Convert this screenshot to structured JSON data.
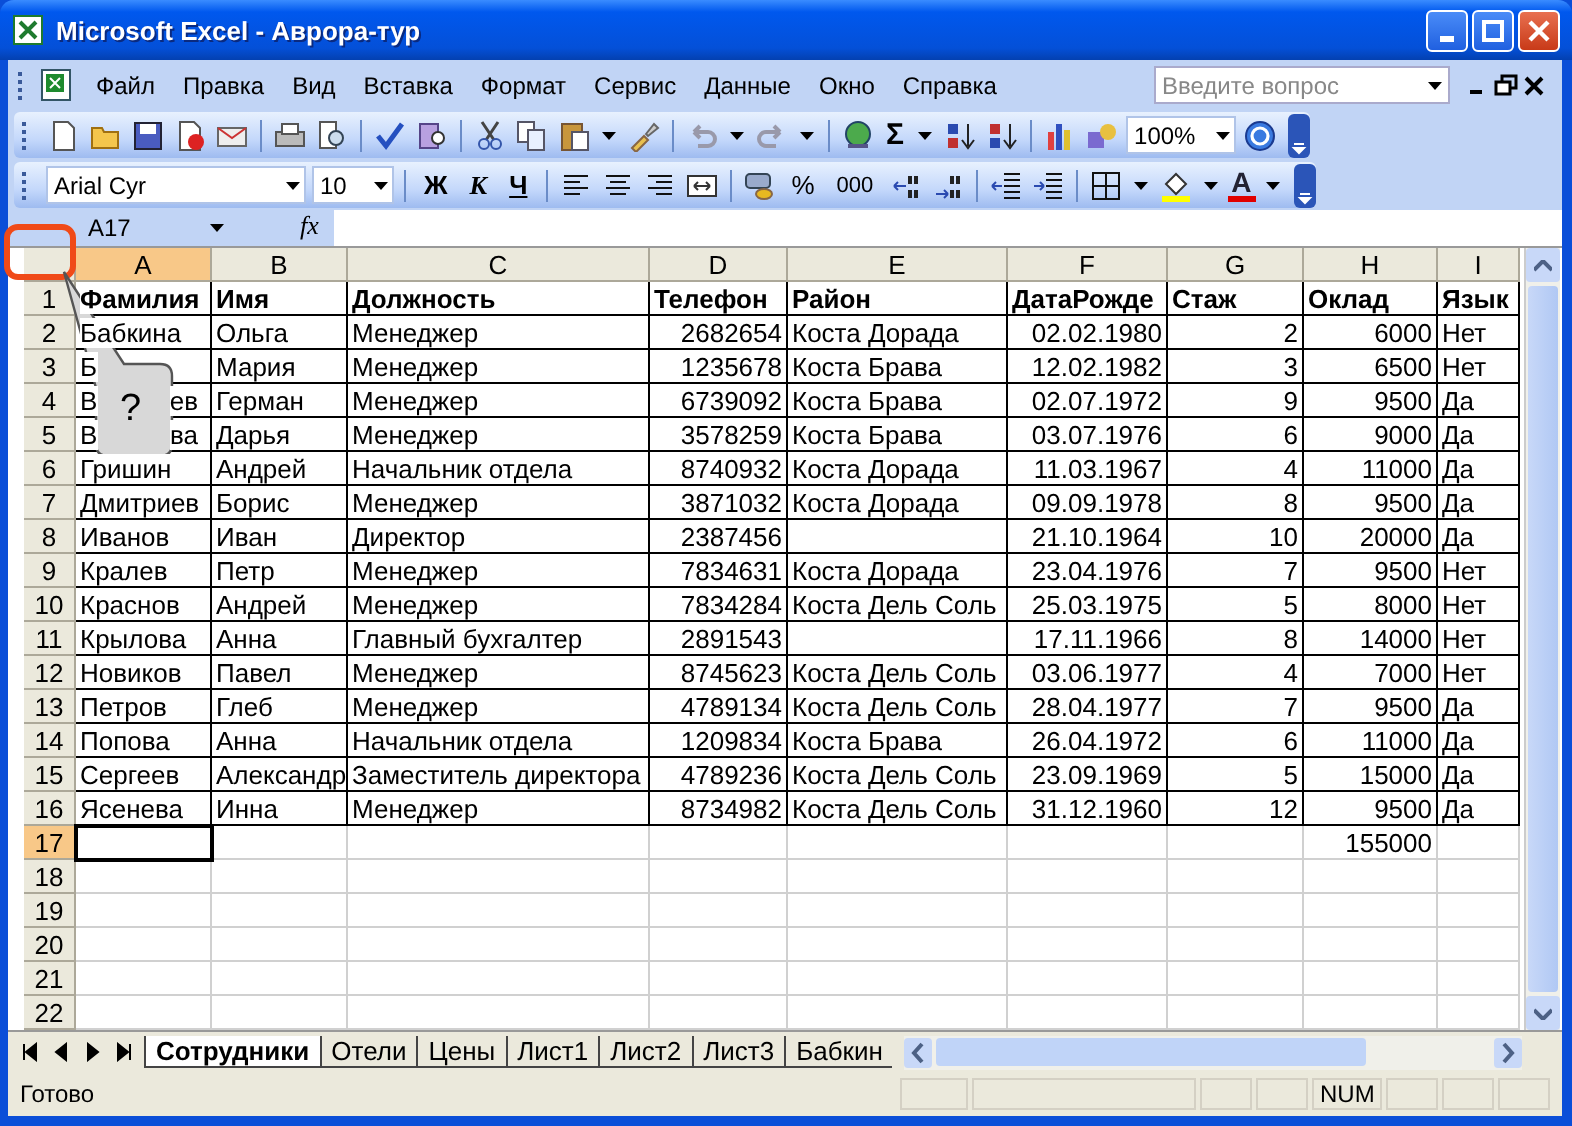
{
  "window": {
    "title": "Microsoft Excel - Аврора-тур"
  },
  "menu": [
    {
      "label": "Файл"
    },
    {
      "label": "Правка"
    },
    {
      "label": "Вид"
    },
    {
      "label": "Вставка"
    },
    {
      "label": "Формат"
    },
    {
      "label": "Сервис"
    },
    {
      "label": "Данные"
    },
    {
      "label": "Окно"
    },
    {
      "label": "Справка"
    }
  ],
  "help_search": {
    "placeholder": "Введите вопрос"
  },
  "standard_toolbar": {
    "sum": "Σ",
    "zoom": "100%"
  },
  "formatting_toolbar": {
    "font": "Arial Cyr",
    "size": "10",
    "bold": "Ж",
    "italic": "К",
    "underline": "Ч",
    "percent": "%",
    "thousands": "000",
    "font_color": "A"
  },
  "formula_bar": {
    "name_box": "A17",
    "fx": "fx"
  },
  "sheet": {
    "columns": [
      {
        "label": "A",
        "selected": true,
        "numeric": false
      },
      {
        "label": "B",
        "selected": false,
        "numeric": false
      },
      {
        "label": "C",
        "selected": false,
        "numeric": false
      },
      {
        "label": "D",
        "selected": false,
        "numeric": true
      },
      {
        "label": "E",
        "selected": false,
        "numeric": false
      },
      {
        "label": "F",
        "selected": false,
        "numeric": true
      },
      {
        "label": "G",
        "selected": false,
        "numeric": true
      },
      {
        "label": "H",
        "selected": false,
        "numeric": true
      },
      {
        "label": "I",
        "selected": false,
        "numeric": false
      }
    ],
    "rows": [
      {
        "number": "1",
        "selected": false,
        "kind": "header",
        "cells": [
          "Фамилия",
          "Имя",
          "Должность",
          "Телефон",
          "Район",
          "ДатаРожде",
          "Стаж",
          "Оклад",
          "Язык"
        ]
      },
      {
        "number": "2",
        "selected": false,
        "kind": "data",
        "cells": [
          "Бабкина",
          "Ольга",
          "Менеджер",
          "2682654",
          "Коста Дорада",
          "02.02.1980",
          "2",
          "6000",
          "Нет"
        ]
      },
      {
        "number": "3",
        "selected": false,
        "kind": "data",
        "cells": [
          {
            "head": "Б"
          },
          "Мария",
          "Менеджер",
          "1235678",
          "Коста Брава",
          "12.02.1982",
          "3",
          "6500",
          "Нет"
        ]
      },
      {
        "number": "4",
        "selected": false,
        "kind": "data",
        "cells": [
          {
            "head": "В",
            "tail": "ев"
          },
          "Герман",
          "Менеджер",
          "6739092",
          "Коста Брава",
          "02.07.1972",
          "9",
          "9500",
          "Да"
        ]
      },
      {
        "number": "5",
        "selected": false,
        "kind": "data",
        "cells": [
          {
            "head": "В",
            "tail": "ва"
          },
          "Дарья",
          "Менеджер",
          "3578259",
          "Коста Брава",
          "03.07.1976",
          "6",
          "9000",
          "Да"
        ]
      },
      {
        "number": "6",
        "selected": false,
        "kind": "data",
        "cells": [
          "Гришин",
          "Андрей",
          "Начальник отдела",
          "8740932",
          "Коста Дорада",
          "11.03.1967",
          "4",
          "11000",
          "Да"
        ]
      },
      {
        "number": "7",
        "selected": false,
        "kind": "data",
        "cells": [
          "Дмитриев",
          "Борис",
          "Менеджер",
          "3871032",
          "Коста Дорада",
          "09.09.1978",
          "8",
          "9500",
          "Да"
        ]
      },
      {
        "number": "8",
        "selected": false,
        "kind": "data",
        "cells": [
          "Иванов",
          "Иван",
          "Директор",
          "2387456",
          null,
          "21.10.1964",
          "10",
          "20000",
          "Да"
        ]
      },
      {
        "number": "9",
        "selected": false,
        "kind": "data",
        "cells": [
          "Кралев",
          "Петр",
          "Менеджер",
          "7834631",
          "Коста Дорада",
          "23.04.1976",
          "7",
          "9500",
          "Нет"
        ]
      },
      {
        "number": "10",
        "selected": false,
        "kind": "data",
        "cells": [
          "Краснов",
          "Андрей",
          "Менеджер",
          "7834284",
          "Коста Дель Соль",
          "25.03.1975",
          "5",
          "8000",
          "Нет"
        ]
      },
      {
        "number": "11",
        "selected": false,
        "kind": "data",
        "cells": [
          "Крылова",
          "Анна",
          "Главный бухгалтер",
          "2891543",
          null,
          "17.11.1966",
          "8",
          "14000",
          "Нет"
        ]
      },
      {
        "number": "12",
        "selected": false,
        "kind": "data",
        "cells": [
          "Новиков",
          "Павел",
          "Менеджер",
          "8745623",
          "Коста Дель Соль",
          "03.06.1977",
          "4",
          "7000",
          "Нет"
        ]
      },
      {
        "number": "13",
        "selected": false,
        "kind": "data",
        "cells": [
          "Петров",
          "Глеб",
          "Менеджер",
          "4789134",
          "Коста Дель Соль",
          "28.04.1977",
          "7",
          "9500",
          "Да"
        ]
      },
      {
        "number": "14",
        "selected": false,
        "kind": "data",
        "cells": [
          "Попова",
          "Анна",
          "Начальник отдела",
          "1209834",
          "Коста Брава",
          "26.04.1972",
          "6",
          "11000",
          "Да"
        ]
      },
      {
        "number": "15",
        "selected": false,
        "kind": "data",
        "cells": [
          "Сергеев",
          "Александр",
          "Заместитель директора",
          "4789236",
          "Коста Дель Соль",
          "23.09.1969",
          "5",
          "15000",
          "Да"
        ]
      },
      {
        "number": "16",
        "selected": false,
        "kind": "data",
        "cells": [
          "Ясенева",
          "Инна",
          "Менеджер",
          "8734982",
          "Коста Дель Соль",
          "31.12.1960",
          "12",
          "9500",
          "Да"
        ]
      },
      {
        "number": "17",
        "selected": true,
        "kind": "empty",
        "cells": [
          null,
          null,
          null,
          null,
          null,
          null,
          null,
          "155000",
          null
        ]
      },
      {
        "number": "18",
        "selected": false,
        "kind": "empty"
      },
      {
        "number": "19",
        "selected": false,
        "kind": "empty"
      },
      {
        "number": "20",
        "selected": false,
        "kind": "empty"
      },
      {
        "number": "21",
        "selected": false,
        "kind": "empty"
      },
      {
        "number": "22",
        "selected": false,
        "kind": "empty"
      }
    ]
  },
  "callout": {
    "text": "?"
  },
  "sheet_tabs": [
    {
      "label": "Сотрудники",
      "selected": true
    },
    {
      "label": "Отели",
      "selected": false
    },
    {
      "label": "Цены",
      "selected": false
    },
    {
      "label": "Лист1",
      "selected": false
    },
    {
      "label": "Лист2",
      "selected": false
    },
    {
      "label": "Лист3",
      "selected": false
    },
    {
      "label": "Бабкин",
      "selected": false
    }
  ],
  "status_bar": {
    "text": "Готово",
    "num": "NUM"
  }
}
